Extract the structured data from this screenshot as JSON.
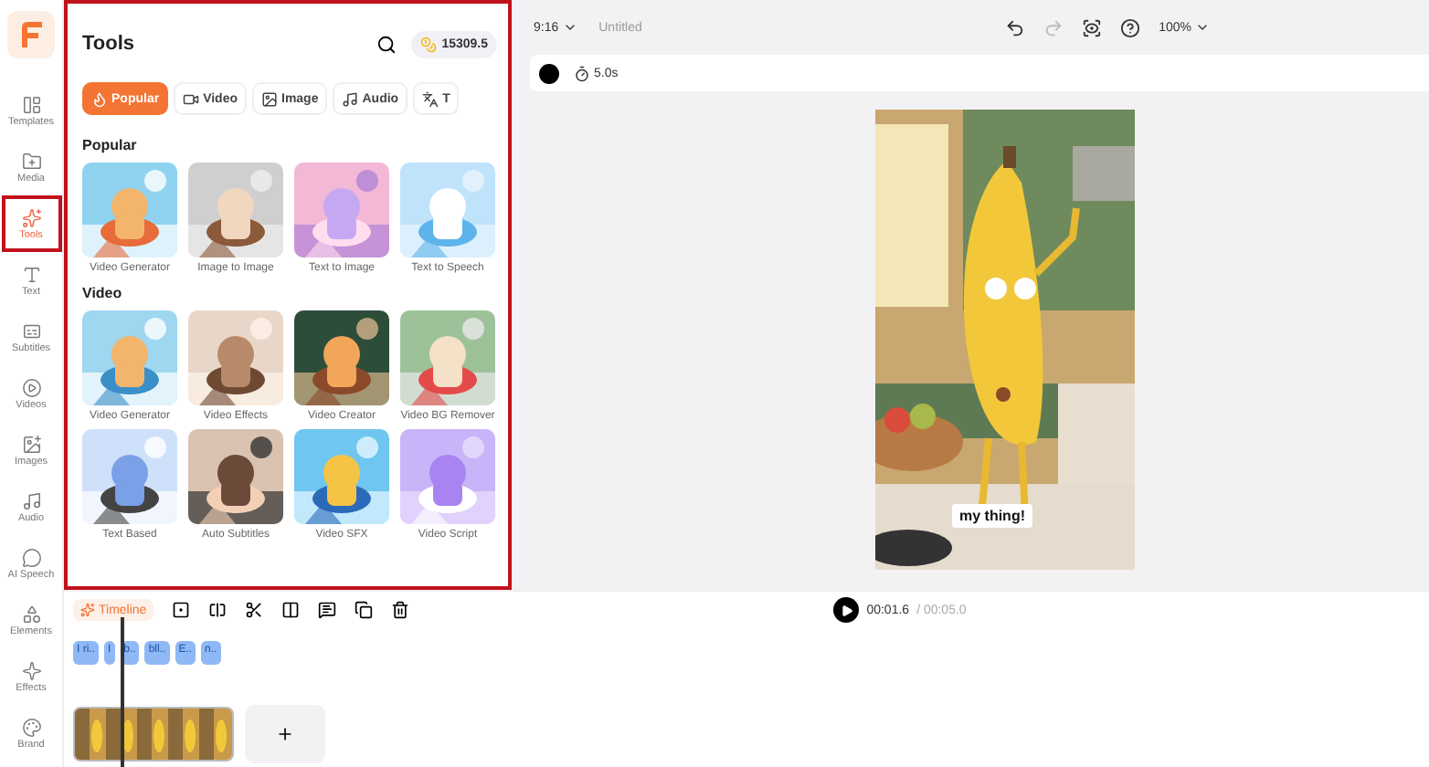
{
  "sidebar": {
    "items": [
      {
        "label": "Templates",
        "selected": false
      },
      {
        "label": "Media",
        "selected": false
      },
      {
        "label": "Tools",
        "selected": true
      },
      {
        "label": "Text",
        "selected": false
      },
      {
        "label": "Subtitles",
        "selected": false
      },
      {
        "label": "Videos",
        "selected": false
      },
      {
        "label": "Images",
        "selected": false
      },
      {
        "label": "Audio",
        "selected": false
      },
      {
        "label": "AI Speech",
        "selected": false
      },
      {
        "label": "Elements",
        "selected": false
      },
      {
        "label": "Effects",
        "selected": false
      },
      {
        "label": "Brand",
        "selected": false
      }
    ]
  },
  "panel": {
    "title": "Tools",
    "credits": "15309.5",
    "tabs": [
      {
        "label": "Popular",
        "selected": true
      },
      {
        "label": "Video",
        "selected": false
      },
      {
        "label": "Image",
        "selected": false
      },
      {
        "label": "Audio",
        "selected": false
      },
      {
        "label": "T",
        "selected": false
      }
    ],
    "sections": [
      {
        "title": "Popular",
        "tools": [
          {
            "label": "Video Generator"
          },
          {
            "label": "Image to Image"
          },
          {
            "label": "Text to Image"
          },
          {
            "label": "Text to Speech"
          }
        ]
      },
      {
        "title": "Video",
        "tools": [
          {
            "label": "Video Generator"
          },
          {
            "label": "Video Effects"
          },
          {
            "label": "Video Creator"
          },
          {
            "label": "Video BG Remover"
          },
          {
            "label": "Text Based"
          },
          {
            "label": "Auto Subtitles"
          },
          {
            "label": "Video SFX"
          },
          {
            "label": "Video Script"
          }
        ]
      }
    ]
  },
  "topbar": {
    "ratio": "9:16",
    "title": "Untitled",
    "redo_disabled": true,
    "zoom": "100%"
  },
  "toolbar": {
    "duration": "5.0s"
  },
  "preview": {
    "caption": "my thing!"
  },
  "player": {
    "current": "00:01.6",
    "total": "/ 00:05.0"
  },
  "timeline": {
    "label": "Timeline",
    "text_clips": [
      "I ri..",
      "I",
      "b..",
      "bll..",
      "E..",
      "n.."
    ]
  }
}
